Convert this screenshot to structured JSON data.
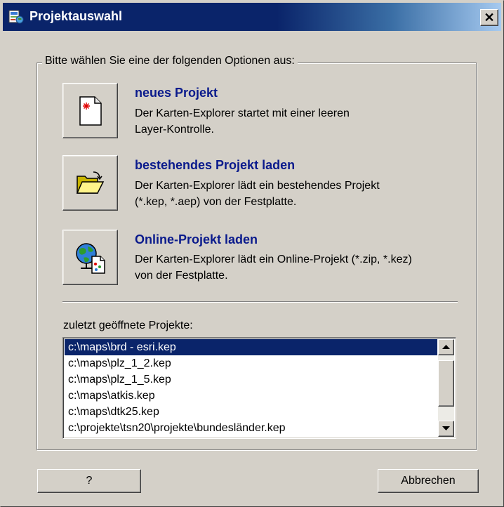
{
  "window": {
    "title": "Projektauswahl",
    "close_glyph": "✕"
  },
  "group": {
    "legend": "Bitte wählen Sie eine der folgenden Optionen aus:"
  },
  "options": [
    {
      "title": "neues Projekt",
      "desc_line1": "Der Karten-Explorer startet mit einer leeren",
      "desc_line2": "Layer-Kontrolle.",
      "icon": "new-document-icon"
    },
    {
      "title": "bestehendes Projekt laden",
      "desc_line1": "Der Karten-Explorer lädt ein bestehendes Projekt",
      "desc_line2": "(*.kep, *.aep)  von der Festplatte.",
      "icon": "open-folder-icon"
    },
    {
      "title": "Online-Projekt laden",
      "desc_line1": "Der Karten-Explorer lädt ein Online-Projekt (*.zip, *.kez)",
      "desc_line2": "von der Festplatte.",
      "icon": "globe-document-icon"
    }
  ],
  "recent": {
    "label": "zuletzt geöffnete Projekte:",
    "items": [
      "c:\\maps\\brd - esri.kep",
      "c:\\maps\\plz_1_2.kep",
      "c:\\maps\\plz_1_5.kep",
      "c:\\maps\\atkis.kep",
      "c:\\maps\\dtk25.kep",
      "c:\\projekte\\tsn20\\projekte\\bundesländer.kep"
    ],
    "selected_index": 0
  },
  "buttons": {
    "help_label": "?",
    "cancel_label": "Abbrechen"
  },
  "colors": {
    "title_bar": "#0a246a",
    "option_title": "#0a1a8c",
    "selection": "#0a246a",
    "face": "#d4d0c8"
  }
}
